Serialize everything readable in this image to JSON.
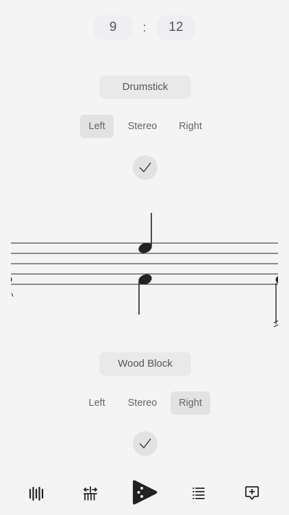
{
  "ratio": {
    "left": "9",
    "separator": ":",
    "right": "12"
  },
  "track1": {
    "sound": "Drumstick",
    "channels": [
      "Left",
      "Stereo",
      "Right"
    ],
    "selected": "Left",
    "enabled": true
  },
  "track2": {
    "sound": "Wood Block",
    "channels": [
      "Left",
      "Stereo",
      "Right"
    ],
    "selected": "Right",
    "enabled": true
  },
  "tabs": [
    {
      "name": "tab-sounds",
      "icon": "waveform-icon"
    },
    {
      "name": "tab-polyrhythm",
      "icon": "polyrhythm-icon"
    },
    {
      "name": "tab-play",
      "icon": "play-icon"
    },
    {
      "name": "tab-list",
      "icon": "list-icon"
    },
    {
      "name": "tab-add",
      "icon": "add-icon"
    }
  ],
  "colors": {
    "background": "#f4f4f4",
    "pill": "#e9e9e9",
    "active": "#e2e2e2",
    "ink": "#222222"
  }
}
